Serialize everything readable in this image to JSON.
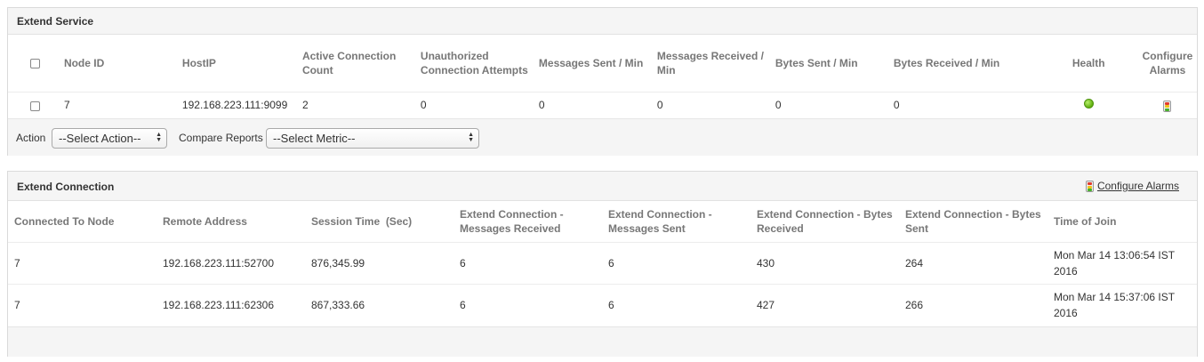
{
  "extend_service": {
    "title": "Extend Service",
    "columns": [
      "Node ID",
      "HostIP",
      "Active Connection Count",
      "Unauthorized Connection Attempts",
      "Messages Sent / Min",
      "Messages Received / Min",
      "Bytes Sent / Min",
      "Bytes Received / Min",
      "Health",
      "Configure Alarms"
    ],
    "rows": [
      {
        "node_id": "7",
        "host_ip": "192.168.223.111:9099",
        "active_connection_count": "2",
        "unauthorized_attempts": "0",
        "messages_sent": "0",
        "messages_received": "0",
        "bytes_sent": "0",
        "bytes_received": "0",
        "health": "green"
      }
    ],
    "action_label": "Action",
    "action_select": "--Select Action--",
    "compare_label": "Compare Reports",
    "metric_select": "--Select Metric--"
  },
  "extend_connection": {
    "title": "Extend Connection",
    "configure_alarms_link": "Configure Alarms",
    "columns": [
      "Connected To Node",
      "Remote Address",
      "Session Time  (Sec)",
      "Extend Connection - Messages Received",
      "Extend Connection - Messages Sent",
      "Extend Connection - Bytes Received",
      "Extend Connection - Bytes Sent",
      "Time of Join"
    ],
    "rows": [
      {
        "node": "7",
        "remote": "192.168.223.111:52700",
        "session": "876,345.99",
        "msg_recv": "6",
        "msg_sent": "6",
        "bytes_recv": "430",
        "bytes_sent": "264",
        "join": "Mon Mar 14 13:06:54 IST 2016"
      },
      {
        "node": "7",
        "remote": "192.168.223.111:62306",
        "session": "867,333.66",
        "msg_recv": "6",
        "msg_sent": "6",
        "bytes_recv": "427",
        "bytes_sent": "266",
        "join": "Mon Mar 14 15:37:06 IST 2016"
      }
    ]
  },
  "colors": {
    "health_ok": "#5fae0e",
    "panel_header_bg": "#f5f5f5",
    "header_text": "#777777"
  }
}
